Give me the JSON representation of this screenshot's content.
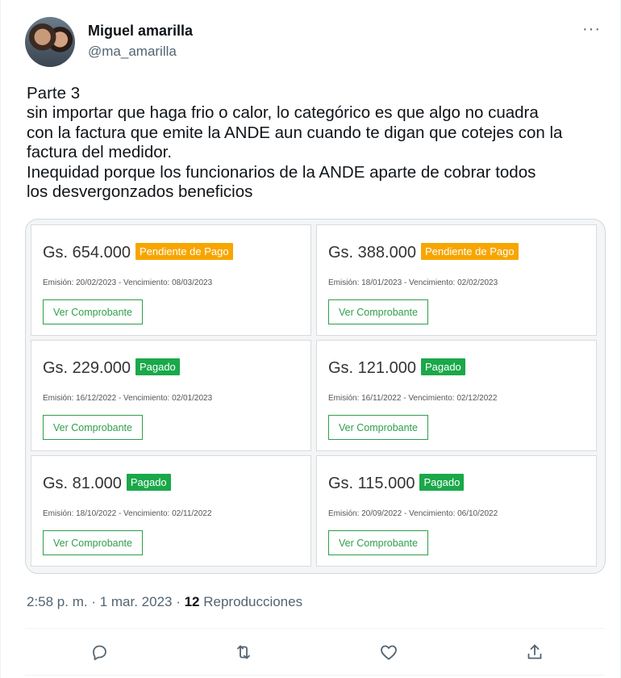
{
  "author": {
    "name": "Miguel amarilla",
    "handle": "@ma_amarilla",
    "avatar_icon": "profile-photo-avatar"
  },
  "more_label": "···",
  "tweet_lines": [
    "Parte 3",
    "sin importar que haga frio o calor, lo categórico es que algo no cuadra",
    "con la factura que emite la ANDE aun cuando te digan que cotejes con la",
    "factura del medidor.",
    "Inequidad porque los funcionarios de la ANDE aparte de cobrar todos",
    "los desvergonzados beneficios"
  ],
  "invoices": [
    {
      "amount": "Gs. 654.000",
      "status": "Pendiente de Pago",
      "status_type": "pending",
      "dates": "Emisión: 20/02/2023 - Vencimiento: 08/03/2023",
      "button": "Ver Comprobante"
    },
    {
      "amount": "Gs. 388.000",
      "status": "Pendiente de Pago",
      "status_type": "pending",
      "dates": "Emisión: 18/01/2023 - Vencimiento: 02/02/2023",
      "button": "Ver Comprobante"
    },
    {
      "amount": "Gs. 229.000",
      "status": "Pagado",
      "status_type": "paid",
      "dates": "Emisión: 16/12/2022 - Vencimiento: 02/01/2023",
      "button": "Ver Comprobante"
    },
    {
      "amount": "Gs. 121.000",
      "status": "Pagado",
      "status_type": "paid",
      "dates": "Emisión: 16/11/2022 - Vencimiento: 02/12/2022",
      "button": "Ver Comprobante"
    },
    {
      "amount": "Gs. 81.000",
      "status": "Pagado",
      "status_type": "paid",
      "dates": "Emisión: 18/10/2022 - Vencimiento: 02/11/2022",
      "button": "Ver Comprobante"
    },
    {
      "amount": "Gs. 115.000",
      "status": "Pagado",
      "status_type": "paid",
      "dates": "Emisión: 20/09/2022 - Vencimiento: 06/10/2022",
      "button": "Ver Comprobante"
    }
  ],
  "colors": {
    "pending": "#f7a600",
    "paid": "#1aa84a",
    "button_border": "#2f9e4b"
  },
  "meta": {
    "time": "2:58 p. m. · 1 mar. 2023 · ",
    "views_count": "12",
    "views_label": " Reproducciones"
  },
  "actions": [
    "reply-icon",
    "retweet-icon",
    "like-icon",
    "share-icon"
  ]
}
